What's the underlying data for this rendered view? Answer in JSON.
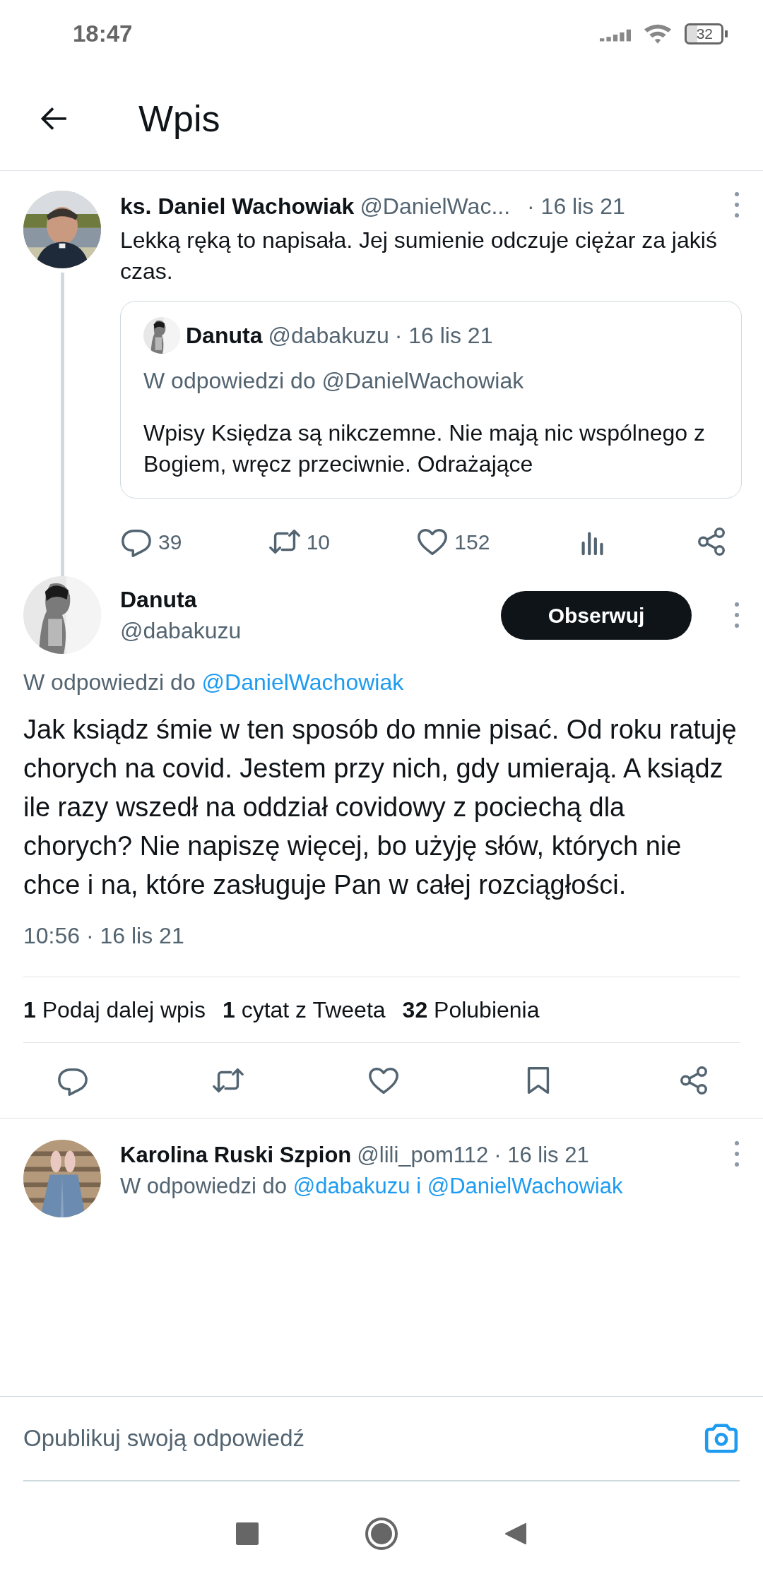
{
  "status_bar": {
    "time": "18:47",
    "battery": "32"
  },
  "header": {
    "title": "Wpis"
  },
  "parent_tweet": {
    "name": "ks. Daniel Wachowiak",
    "handle": "@DanielWac...",
    "date": "· 16 lis 21",
    "text": "Lekką ręką to napisała. Jej sumienie odczuje ciężar za jakiś czas.",
    "quote": {
      "name": "Danuta",
      "handle": "@dabakuzu",
      "date": "· 16 lis 21",
      "reply_to": "W odpowiedzi do @DanielWachowiak",
      "text": "Wpisy Księdza są nikczemne. Nie mają nic wspólnego z Bogiem, wręcz przeciwnie. Odrażające"
    },
    "actions": [
      {
        "kind": "reply",
        "count": "39"
      },
      {
        "kind": "retweet",
        "count": "10"
      },
      {
        "kind": "like",
        "count": "152"
      },
      {
        "kind": "views"
      },
      {
        "kind": "share"
      }
    ]
  },
  "main_tweet": {
    "name": "Danuta",
    "handle": "@dabakuzu",
    "follow_button": "Obserwuj",
    "reply_prefix": "W odpowiedzi do",
    "reply_to": "@DanielWachowiak",
    "text": "Jak ksiądz śmie w ten sposób do mnie pisać. Od roku ratuję chorych na covid. Jestem przy nich, gdy umierają. A ksiądz ile razy wszedł na oddział covidowy z pociechą dla chorych? Nie napiszę więcej, bo użyję słów, których nie chce i na, które zasługuje Pan w całej rozciągłości.",
    "timestamp": "10:56 · 16 lis 21",
    "stats": [
      {
        "count": "1",
        "label": "Podaj dalej wpis"
      },
      {
        "count": "1",
        "label": "cytat z Tweeta"
      },
      {
        "count": "32",
        "label": "Polubienia"
      }
    ],
    "actions": [
      {
        "kind": "reply"
      },
      {
        "kind": "retweet"
      },
      {
        "kind": "like"
      },
      {
        "kind": "bookmark"
      },
      {
        "kind": "share"
      }
    ]
  },
  "reply_tweet": {
    "name": "Karolina",
    "name_rest": "Ruski Szpion",
    "handle": "@lili_pom112",
    "date": "· 16 lis 21",
    "reply_prefix": "W odpowiedzi do",
    "reply_to": "@dabakuzu i @DanielWachowiak"
  },
  "composer": {
    "placeholder": "Opublikuj swoją odpowiedź"
  }
}
